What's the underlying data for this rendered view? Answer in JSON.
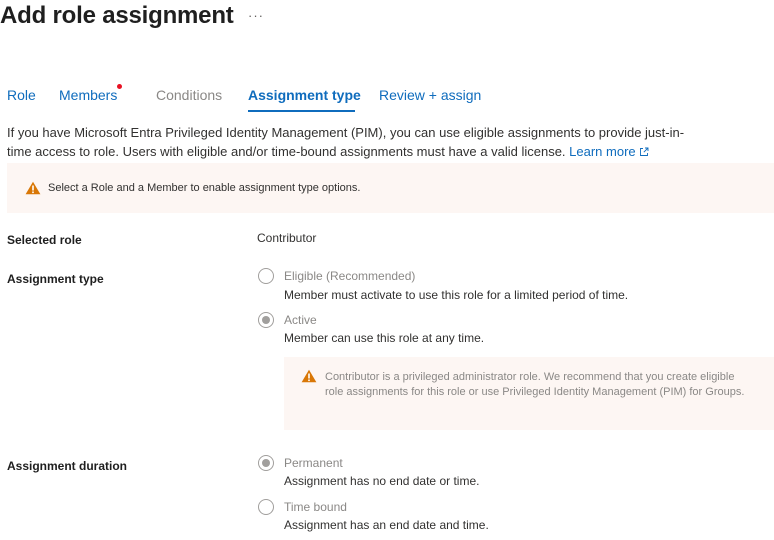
{
  "header": {
    "title": "Add role assignment",
    "more": "···"
  },
  "tabs": [
    {
      "label": "Role",
      "state": "enabled"
    },
    {
      "label": "Members",
      "state": "enabled",
      "has_indicator": true
    },
    {
      "label": "Conditions",
      "state": "disabled"
    },
    {
      "label": "Assignment type",
      "state": "active"
    },
    {
      "label": "Review + assign",
      "state": "enabled"
    }
  ],
  "intro": {
    "text": "If you have Microsoft Entra Privileged Identity Management (PIM), you can use eligible assignments to provide just-in-time access to role. Users with eligible and/or time-bound assignments must have a valid license. ",
    "link": "Learn more"
  },
  "banner": {
    "text": "Select a Role and a Member to enable assignment type options."
  },
  "selected_role": {
    "label": "Selected role",
    "value": "Contributor"
  },
  "assignment_type": {
    "label": "Assignment type",
    "options": [
      {
        "label": "Eligible (Recommended)",
        "description": "Member must activate to use this role for a limited period of time.",
        "checked": false
      },
      {
        "label": "Active",
        "description": "Member can use this role at any time.",
        "checked": true
      }
    ],
    "warning": "Contributor is a privileged administrator role. We recommend that you create eligible role assignments for this role or use Privileged Identity Management (PIM) for Groups."
  },
  "assignment_duration": {
    "label": "Assignment duration",
    "options": [
      {
        "label": "Permanent",
        "description": "Assignment has no end date or time.",
        "checked": true
      },
      {
        "label": "Time bound",
        "description": "Assignment has an end date and time.",
        "checked": false
      }
    ]
  },
  "colors": {
    "accent": "#0f6cbd",
    "warning": "#d97706",
    "warning_bg": "#fdf6f3",
    "indicator": "#e81123"
  },
  "icons": {
    "warning": "warning-triangle-icon",
    "external": "external-link-icon"
  }
}
